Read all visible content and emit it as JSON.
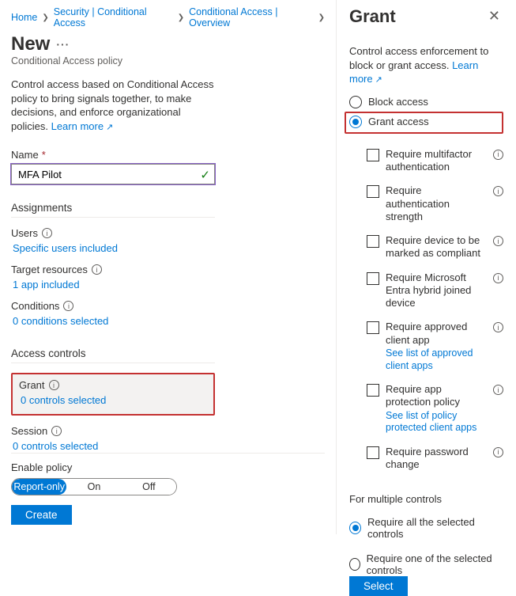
{
  "breadcrumb": {
    "home": "Home",
    "sec": "Security | Conditional Access",
    "overview": "Conditional Access | Overview"
  },
  "left": {
    "title": "New",
    "subtitle": "Conditional Access policy",
    "desc": "Control access based on Conditional Access policy to bring signals together, to make decisions, and enforce organizational policies.",
    "learn_more": "Learn more",
    "name_label": "Name",
    "name_value": "MFA Pilot",
    "assignments_title": "Assignments",
    "users_label": "Users",
    "users_link": "Specific users included",
    "target_label": "Target resources",
    "target_link": "1 app included",
    "conditions_label": "Conditions",
    "conditions_link": "0 conditions selected",
    "access_controls_title": "Access controls",
    "grant_label": "Grant",
    "grant_link": "0 controls selected",
    "session_label": "Session",
    "session_link": "0 controls selected",
    "enable_label": "Enable policy",
    "seg_report": "Report-only",
    "seg_on": "On",
    "seg_off": "Off",
    "create_btn": "Create"
  },
  "right": {
    "title": "Grant",
    "desc": "Control access enforcement to block or grant access.",
    "learn_more": "Learn more",
    "block": "Block access",
    "grant": "Grant access",
    "chk_mfa": "Require multifactor authentication",
    "chk_strength": "Require authentication strength",
    "chk_compliant": "Require device to be marked as compliant",
    "chk_hybrid": "Require Microsoft Entra hybrid joined device",
    "chk_client": "Require approved client app",
    "chk_client_link": "See list of approved client apps",
    "chk_protection": "Require app protection policy",
    "chk_protection_link": "See list of policy protected client apps",
    "chk_pwd": "Require password change",
    "multi_title": "For multiple controls",
    "multi_all": "Require all the selected controls",
    "multi_one": "Require one of the selected controls",
    "select_btn": "Select"
  }
}
